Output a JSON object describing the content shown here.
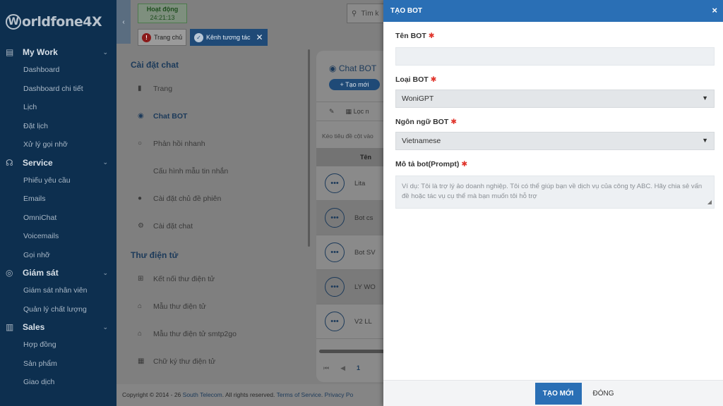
{
  "brand": {
    "logo_w": "W",
    "logo_rest": "orldfone4X"
  },
  "sidebar": {
    "groups": [
      {
        "label": "My Work",
        "items": [
          "Dashboard",
          "Dashboard chi tiết",
          "Lịch",
          "Đặt lịch",
          "Xử lý gọi nhỡ"
        ]
      },
      {
        "label": "Service",
        "items": [
          "Phiếu yêu cầu",
          "Emails",
          "OmniChat",
          "Voicemails",
          "Gọi nhỡ"
        ]
      },
      {
        "label": "Giám sát",
        "items": [
          "Giám sát nhân viên",
          "Quản lý chất lượng"
        ]
      },
      {
        "label": "Sales",
        "items": [
          "Hợp đồng",
          "Sản phẩm",
          "Giao dịch"
        ]
      }
    ]
  },
  "topbar": {
    "status_label": "Hoạt động",
    "status_time": "24:21:13",
    "tabs": [
      {
        "label": "Trang chủ"
      },
      {
        "label": "Kênh tương tác"
      }
    ],
    "search_placeholder": "Tìm k"
  },
  "settings": {
    "section1_title": "Cài đặt chat",
    "section1_items": [
      "Trang",
      "Chat BOT",
      "Phản hồi nhanh",
      "Cấu hình mẫu tin nhắn",
      "Cài đặt chủ đề phiên",
      "Cài đặt chat"
    ],
    "section2_title": "Thư điện tử",
    "section2_items": [
      "Kết nối thư điện tử",
      "Mẫu thư điện tử",
      "Mẫu thư điện tử smtp2go",
      "Chữ ký thư điện tử"
    ]
  },
  "listpanel": {
    "title": "Chat BOT",
    "new_button": "+ Tạo mới",
    "filter_label": "Lọc n",
    "drag_hint": "Kéo tiêu đề cột vào",
    "column_name": "Tên",
    "rows": [
      "Lita",
      "Bot cs",
      "Bot SV",
      "LY WO",
      "V2 LL"
    ],
    "pager_first": "⏮",
    "pager_prev": "◀",
    "pager_current": "1"
  },
  "footer": {
    "prefix": "Copyright © 2014 - 26 ",
    "company": "South Telecom",
    "rights": ". All rights reserved. ",
    "terms": "Terms of Service",
    "sep": ". ",
    "privacy": "Privacy Po"
  },
  "modal": {
    "title": "TẠO BOT",
    "close_icon": "×",
    "name_label": "Tên BOT",
    "name_value": "",
    "type_label": "Loại BOT",
    "type_value": "WoniGPT",
    "lang_label": "Ngôn ngữ BOT",
    "lang_value": "Vietnamese",
    "prompt_label": "Mô tả bot(Prompt)",
    "prompt_placeholder": "Ví dụ: Tôi là trợ lý ảo doanh nghiệp. Tôi có thể giúp bạn về dịch vụ của công ty ABC. Hãy chia sẻ vấn đề hoặc tác vụ cụ thể mà bạn muốn tôi hỗ trợ",
    "submit_label": "TẠO MỚI",
    "cancel_label": "ĐÓNG"
  },
  "colors": {
    "accent": "#2a6fb5",
    "sidebar_bg": "#0d2f4f",
    "required": "#e0342b"
  }
}
